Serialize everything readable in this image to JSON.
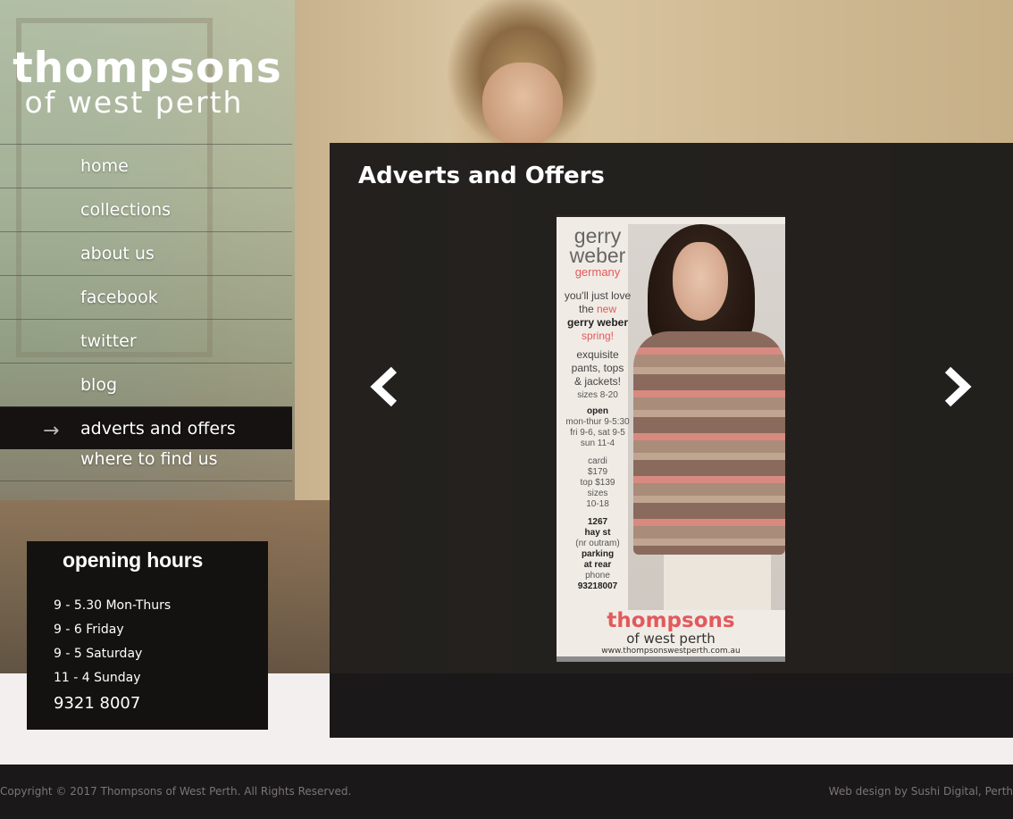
{
  "logo": {
    "line1": "thompsons",
    "line2": "of west perth"
  },
  "nav": {
    "items": [
      {
        "label": "home"
      },
      {
        "label": "collections"
      },
      {
        "label": "about us"
      },
      {
        "label": "facebook"
      },
      {
        "label": "twitter"
      },
      {
        "label": "blog"
      },
      {
        "label": "adverts and offers",
        "active": true
      },
      {
        "label": "where to find us"
      }
    ],
    "active_arrow": "→"
  },
  "hours": {
    "title": "opening hours",
    "rows": [
      "9 - 5.30 Mon-Thurs",
      "9 - 6 Friday",
      "9 - 5 Saturday",
      "11 - 4 Sunday"
    ],
    "phone": "9321 8007"
  },
  "main": {
    "title": "Adverts and Offers",
    "prev_icon": "chevron-left-icon",
    "next_icon": "chevron-right-icon"
  },
  "advert": {
    "brand1": "gerry",
    "brand2": "weber",
    "country": "germany",
    "tag1": "you'll just love",
    "tag2a": "the ",
    "tag2b": "new",
    "tag3": "gerry weber",
    "tag4": "spring!",
    "tag5": "exquisite",
    "tag6": "pants, tops",
    "tag7": "& jackets!",
    "sizes": "sizes 8-20",
    "open_label": "open",
    "open1": "mon-thur 9-5:30",
    "open2": "fri 9-6, sat 9-5",
    "open3": "sun 11-4",
    "price1": "cardi",
    "price2": "$179",
    "price3": "top $139",
    "price4": "sizes",
    "price5": "10-18",
    "addr1": "1267",
    "addr2": "hay st",
    "addr3": "(nr outram)",
    "addr4": "parking",
    "addr5": "at rear",
    "addr6": "phone",
    "addr7": "93218007",
    "footer1": "thompsons",
    "footer2": "of west perth",
    "footer3": "www.thompsonswestperth.com.au"
  },
  "footer": {
    "copyright": "Copyright © 2017 Thompsons of West Perth. All Rights Reserved.",
    "credit": "Web design by Sushi Digital, Perth"
  },
  "colors": {
    "panel": "#161414",
    "accent_red": "#e2595c",
    "page_bg": "#f3efef"
  }
}
